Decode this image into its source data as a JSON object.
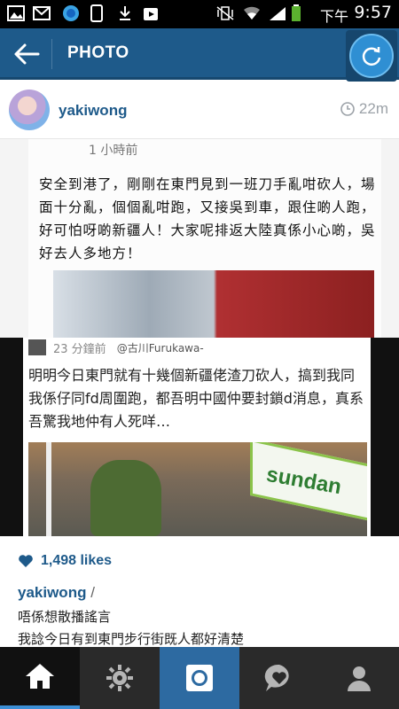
{
  "status_bar": {
    "lang": "下午",
    "time": "9:57"
  },
  "header": {
    "title": "PHOTO"
  },
  "post": {
    "username": "yakiwong",
    "time_ago": "22m"
  },
  "photo": {
    "card1_time": "1 小時前",
    "card1_text": "安全到港了，剛剛在東門見到一班刀手亂咁砍人，場面十分亂，個個亂咁跑，又接吳到車，跟住啲人跑，好可怕呀啲新疆人！大家呢排返大陸真係小心啲，吳好去人多地方！",
    "card2_time": "23 分鐘前",
    "card2_watermark": "@古川Furukawa-",
    "card2_text": "明明今日東門就有十幾個新疆佬渣刀砍人，搞到我同我係仔同fd周圍跑，都吾明中國仲要封鎖d消息，真系吾驚我地仲有人死咩…",
    "sign_text": "sundan"
  },
  "likes": {
    "count_label": "1,498 likes"
  },
  "caption": {
    "username": "yakiwong",
    "slash": " /",
    "line1": "唔係想散播謠言",
    "line2": "我諗今日有到東門步行街既人都好清楚"
  },
  "colors": {
    "accent": "#1e5a8a",
    "nav_active": "#2d6aa1",
    "nav_bg": "#2a2a2a"
  },
  "nav": {
    "items": [
      "home-icon",
      "explore-icon",
      "camera-icon",
      "news-icon",
      "profile-icon"
    ]
  }
}
